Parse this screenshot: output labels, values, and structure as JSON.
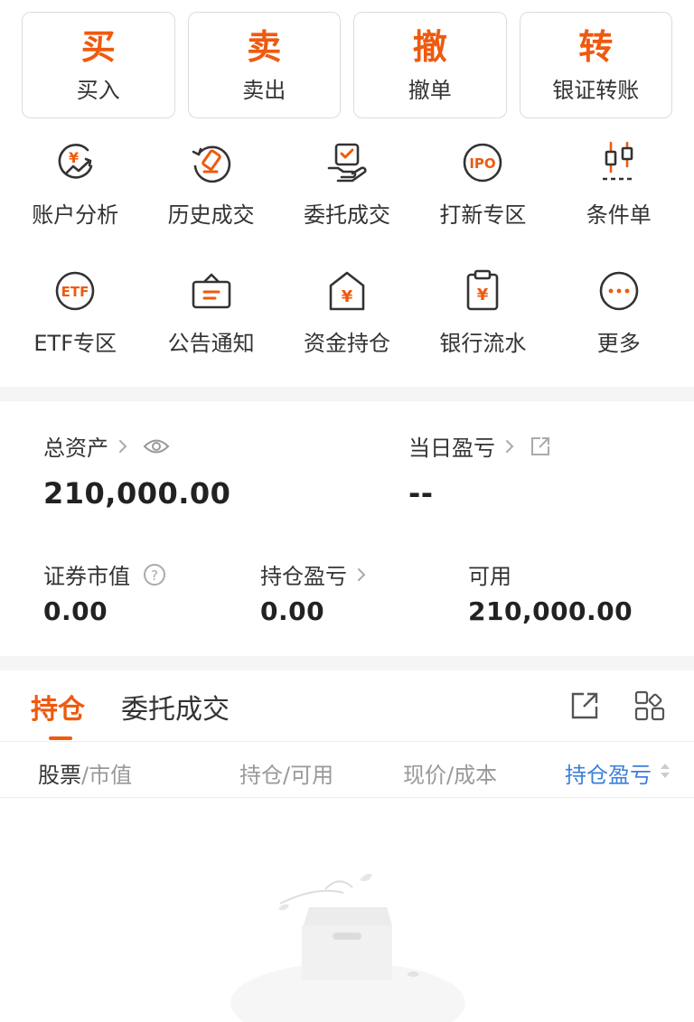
{
  "theme": {
    "accent": "#ee5a0f",
    "link_blue": "#3b7fd9",
    "muted": "#999999",
    "text": "#222222"
  },
  "trade_buttons": [
    {
      "big": "买",
      "label": "买入"
    },
    {
      "big": "卖",
      "label": "卖出"
    },
    {
      "big": "撤",
      "label": "撤单"
    },
    {
      "big": "转",
      "label": "银证转账"
    }
  ],
  "functions": [
    {
      "label": "账户分析",
      "icon": "account-analysis-icon"
    },
    {
      "label": "历史成交",
      "icon": "history-trade-icon"
    },
    {
      "label": "委托成交",
      "icon": "order-trade-icon"
    },
    {
      "label": "打新专区",
      "icon": "ipo-icon"
    },
    {
      "label": "条件单",
      "icon": "condition-order-icon"
    },
    {
      "label": "ETF专区",
      "icon": "etf-icon"
    },
    {
      "label": "公告通知",
      "icon": "announcement-icon"
    },
    {
      "label": "资金持仓",
      "icon": "funds-position-icon"
    },
    {
      "label": "银行流水",
      "icon": "bank-statement-icon"
    },
    {
      "label": "更多",
      "icon": "more-icon"
    }
  ],
  "assets": {
    "total_label": "总资产",
    "total_value": "210,000.00",
    "daily_pl_label": "当日盈亏",
    "daily_pl_value": "--",
    "market_value_label": "证券市值",
    "market_value": "0.00",
    "position_pl_label": "持仓盈亏",
    "position_pl_value": "0.00",
    "available_label": "可用",
    "available_value": "210,000.00"
  },
  "tabs": [
    {
      "label": "持仓",
      "active": true
    },
    {
      "label": "委托成交",
      "active": false
    }
  ],
  "columns": {
    "stock": "股票",
    "market_value": "/市值",
    "position": "持仓/可用",
    "price": "现价/成本",
    "pl": "持仓盈亏"
  }
}
